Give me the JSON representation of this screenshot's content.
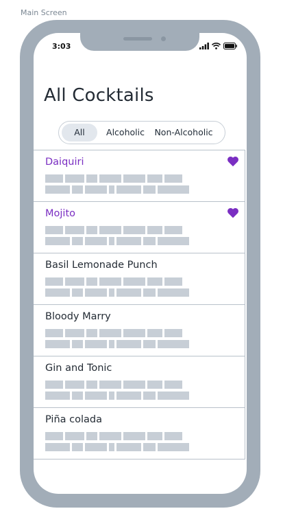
{
  "canvas_label": "Main Screen",
  "status_bar": {
    "time": "3:03"
  },
  "title": "All Cocktails",
  "filters": [
    {
      "label": "All",
      "active": true
    },
    {
      "label": "Alcoholic",
      "active": false
    },
    {
      "label": "Non-Alcoholic",
      "active": false
    }
  ],
  "cocktails": [
    {
      "name": "Daiquiri",
      "favorite": true
    },
    {
      "name": "Mojito",
      "favorite": true
    },
    {
      "name": "Basil Lemonade Punch",
      "favorite": false
    },
    {
      "name": "Bloody Marry",
      "favorite": false
    },
    {
      "name": "Gin and Tonic",
      "favorite": false
    },
    {
      "name": "Piña colada",
      "favorite": false
    }
  ],
  "colors": {
    "favorite": "#7a2ec2",
    "frame": "#a2adb8",
    "placeholder": "#c7ced6"
  }
}
